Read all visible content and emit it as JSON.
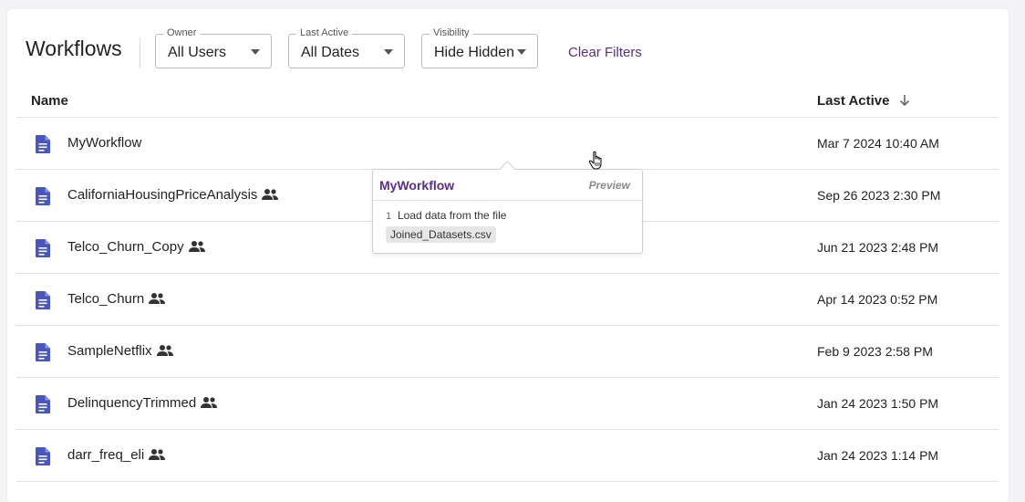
{
  "page": {
    "title": "Workflows"
  },
  "filters": {
    "owner": {
      "label": "Owner",
      "value": "All Users"
    },
    "last_active": {
      "label": "Last Active",
      "value": "All Dates"
    },
    "visibility": {
      "label": "Visibility",
      "value": "Hide Hidden"
    },
    "clear_label": "Clear Filters"
  },
  "table": {
    "columns": {
      "name": "Name",
      "last_active": "Last Active"
    },
    "sort": "descending",
    "rows": [
      {
        "name": "MyWorkflow",
        "date": "Mar 7 2024 10:40 AM",
        "shared": false
      },
      {
        "name": "CaliforniaHousingPriceAnalysis",
        "date": "Sep 26 2023 2:30 PM",
        "shared": true
      },
      {
        "name": "Telco_Churn_Copy",
        "date": "Jun 21 2023 2:48 PM",
        "shared": true
      },
      {
        "name": "Telco_Churn",
        "date": "Apr 14 2023 0:52 PM",
        "shared": true
      },
      {
        "name": "SampleNetflix",
        "date": "Feb 9 2023 2:58 PM",
        "shared": true
      },
      {
        "name": "DelinquencyTrimmed",
        "date": "Jan 24 2023 1:50 PM",
        "shared": true
      },
      {
        "name": "darr_freq_eli",
        "date": "Jan 24 2023 1:14 PM",
        "shared": true
      }
    ]
  },
  "tooltip": {
    "title": "MyWorkflow",
    "preview_label": "Preview",
    "step_number": "1",
    "step_text": "Load data from the file",
    "file_name": "Joined_Datasets.csv"
  },
  "icons": {
    "row_icon": "document-icon",
    "shared_icon": "people-icon",
    "sort_icon": "arrow-down-icon",
    "cursor": "hand-pointer-icon"
  },
  "colors": {
    "accent": "#5b2d8e",
    "doc_icon": "#4a56c0",
    "border": "#e2e2e2"
  }
}
